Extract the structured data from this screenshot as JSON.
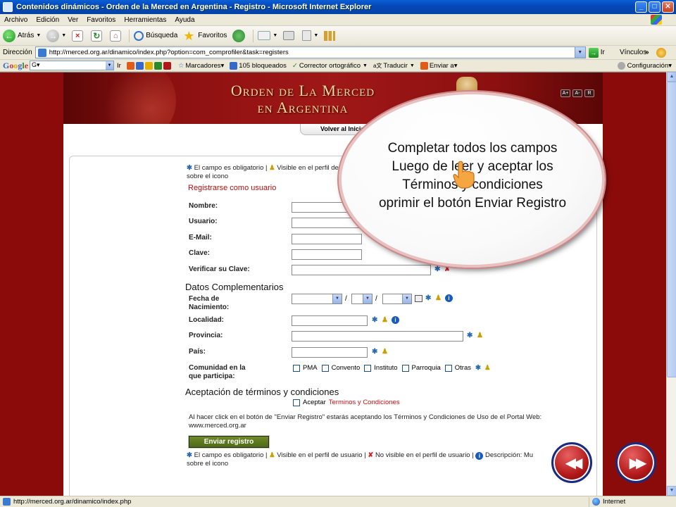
{
  "window": {
    "title": "Contenidos dinámicos - Orden de la Merced en Argentina - Registro - Microsoft Internet Explorer",
    "min": "_",
    "max": "□",
    "close": "✕"
  },
  "menu": [
    "Archivo",
    "Edición",
    "Ver",
    "Favoritos",
    "Herramientas",
    "Ayuda"
  ],
  "toolbar": {
    "back": "Atrás",
    "search": "Búsqueda",
    "favorites": "Favoritos"
  },
  "address": {
    "label": "Dirección",
    "url": "http://merced.org.ar/dinamico/index.php?option=com_comprofiler&task=registers",
    "go": "Ir",
    "links": "Vínculos",
    "chevron": "»"
  },
  "google": {
    "search_placeholder": "G▾",
    "go": "Ir",
    "bookmarks": "Marcadores▾",
    "blocked": "105 bloqueados",
    "spell": "Corrector ortográfico",
    "translate": "Traducir",
    "send": "Enviar a▾",
    "settings": "Configuración▾"
  },
  "site": {
    "title_line1": "Orden de La Merced",
    "title_line2": "en Argentina",
    "font_buttons": [
      "A+",
      "A-",
      "R"
    ],
    "back_home": "Volver al Inicio"
  },
  "form": {
    "legend_top_1": "El campo es obligatorio |",
    "legend_top_2": "Visible en el perfil de usuario |",
    "legend_top_3": "sobre el icono",
    "register_title": "Registrarse como usuario",
    "fields": {
      "nombre": "Nombre:",
      "usuario": "Usuario:",
      "email": "E-Mail:",
      "clave": "Clave:",
      "verificar": "Verificar su Clave:"
    },
    "datos_title": "Datos Complementarios",
    "fecha_1": "Fecha de",
    "fecha_2": "Nacimiento:",
    "localidad": "Localidad:",
    "provincia": "Provincia:",
    "pais": "País:",
    "comunidad_1": "Comunidad en la",
    "comunidad_2": "que participa:",
    "comunidad_opts": [
      "PMA",
      "Convento",
      "Instituto",
      "Parroquia",
      "Otras"
    ],
    "terms_title": "Aceptación de términos y condiciones",
    "accept": "Aceptar",
    "terms_link": "Terminos y Condiciones",
    "note": "Al hacer click en el botón de \"Enviar Registro\" estarás aceptando los Términos y Condiciones de Uso de el Portal Web: www.merced.org.ar",
    "submit": "Enviar registro",
    "legend_bottom_1": "El campo es obligatorio |",
    "legend_bottom_2": "Visible en el perfil de usuario |",
    "legend_bottom_3": "No visible en el perfil de usuario |",
    "legend_bottom_4": "Descripción: Mu",
    "legend_bottom_5": "sobre el icono"
  },
  "callout": {
    "line1": "Completar todos los campos",
    "line2": "Luego de leer y aceptar los",
    "line3": "Términos y condiciones",
    "line4": "oprimir el botón Enviar Registro"
  },
  "nav": {
    "prev": "◀◀",
    "next": "▶▶"
  },
  "status": {
    "url": "http://merced.org.ar/dinamico/index.php",
    "zone": "Internet"
  },
  "colors": {
    "accent_red": "#8b0b0b",
    "required": "#2a6ab0",
    "visible": "#c8a000",
    "not_visible": "#c22222",
    "submit": "#5a7a1c"
  }
}
